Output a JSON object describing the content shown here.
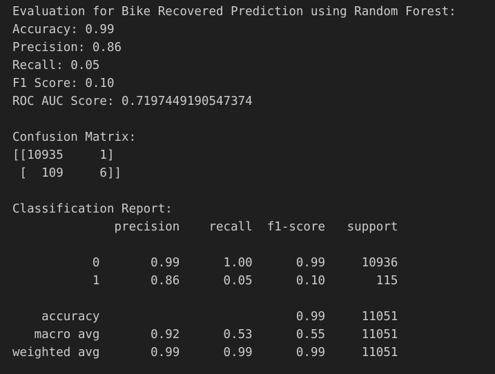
{
  "terminal": {
    "lines": [
      "Evaluation for Bike Recovered Prediction using Random Forest:",
      "Accuracy: 0.99",
      "Precision: 0.86",
      "Recall: 0.05",
      "F1 Score: 0.10",
      "ROC AUC Score: 0.7197449190547374",
      "",
      "Confusion Matrix:",
      "[[10935     1]",
      " [  109     6]]",
      "",
      "Classification Report:",
      "              precision    recall  f1-score   support",
      "",
      "           0       0.99      1.00      0.99     10936",
      "           1       0.86      0.05      0.10       115",
      "",
      "    accuracy                           0.99     11051",
      "   macro avg       0.92      0.53      0.55     11051",
      "weighted avg       0.99      0.99      0.99     11051"
    ]
  },
  "colors": {
    "background": "#1f1f1f",
    "text": "#cccccc"
  }
}
